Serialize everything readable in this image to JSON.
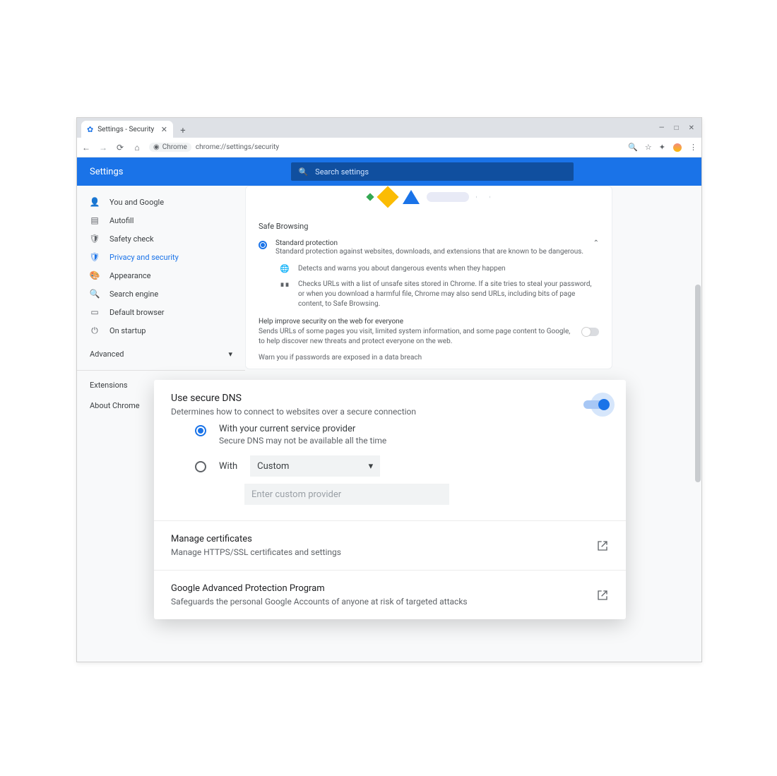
{
  "tab": {
    "title": "Settings - Security"
  },
  "address": {
    "scheme_label": "Chrome",
    "url": "chrome://settings/security"
  },
  "header": {
    "title": "Settings",
    "search_placeholder": "Search settings"
  },
  "sidebar": {
    "items": [
      {
        "label": "You and Google"
      },
      {
        "label": "Autofill"
      },
      {
        "label": "Safety check"
      },
      {
        "label": "Privacy and security"
      },
      {
        "label": "Appearance"
      },
      {
        "label": "Search engine"
      },
      {
        "label": "Default browser"
      },
      {
        "label": "On startup"
      }
    ],
    "advanced": "Advanced",
    "extensions": "Extensions",
    "about": "About Chrome"
  },
  "safe": {
    "section": "Safe Browsing",
    "std_title": "Standard protection",
    "std_sub": "Standard protection against websites, downloads, and extensions that are known to be dangerous.",
    "b1": "Detects and warns you about dangerous events when they happen",
    "b2": "Checks URLs with a list of unsafe sites stored in Chrome. If a site tries to steal your password, or when you download a harmful file, Chrome may also send URLs, including bits of page content, to Safe Browsing.",
    "improve_title": "Help improve security on the web for everyone",
    "improve_sub": "Sends URLs of some pages you visit, limited system information, and some page content to Google, to help discover new threats and protect everyone on the web.",
    "warn": "Warn you if passwords are exposed in a data breach"
  },
  "bottom": {
    "sub": "Safeguards the personal Google Accounts of anyone at risk of targeted attacks"
  },
  "overlay": {
    "dns_title": "Use secure DNS",
    "dns_sub": "Determines how to connect to websites over a secure connection",
    "opt1_title": "With your current service provider",
    "opt1_sub": "Secure DNS may not be available all the time",
    "with_label": "With",
    "dropdown_value": "Custom",
    "input_placeholder": "Enter custom provider",
    "cert_title": "Manage certificates",
    "cert_sub": "Manage HTTPS/SSL certificates and settings",
    "gapp_title": "Google Advanced Protection Program",
    "gapp_sub": "Safeguards the personal Google Accounts of anyone at risk of targeted attacks"
  }
}
